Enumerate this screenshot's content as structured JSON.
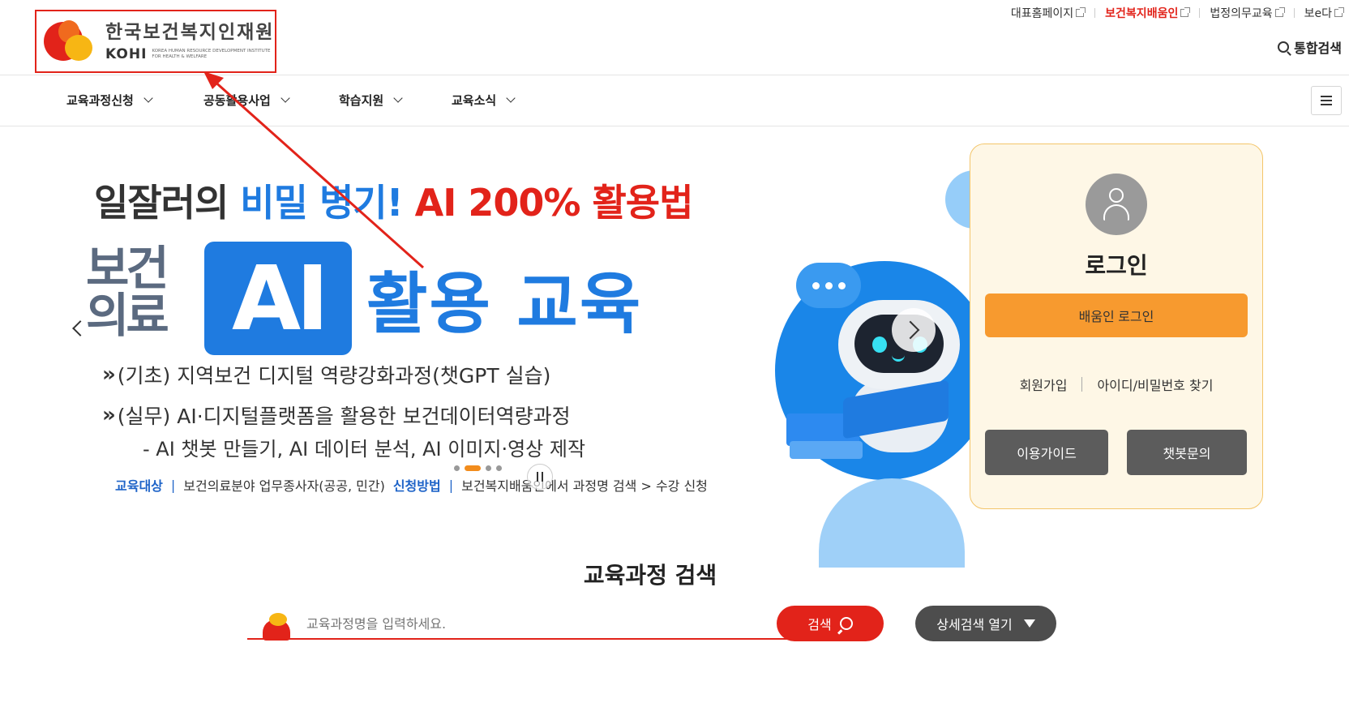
{
  "logo": {
    "name_kr": "한국보건복지인재원",
    "name_en": "KOHI",
    "full_name": "KOREA HUMAN RESOURCE DEVELOPMENT INSTITUTE FOR HEALTH & WELFARE"
  },
  "util_links": [
    {
      "label": "대표홈페이지"
    },
    {
      "label": "보건복지배움인"
    },
    {
      "label": "법정의무교육"
    },
    {
      "label": "보e다"
    }
  ],
  "total_search": "통합검색",
  "gnb": [
    {
      "label": "교육과정신청"
    },
    {
      "label": "공동활용사업"
    },
    {
      "label": "학습지원"
    },
    {
      "label": "교육소식"
    }
  ],
  "banner": {
    "headline_1": "일잘러의",
    "headline_2": "비밀 병기!",
    "headline_3": "AI 200% 활용법",
    "stack_line1": "보건",
    "stack_line2": "의료",
    "ai_box": "AI",
    "title": "활용 교육",
    "bullet_1": "(기초) 지역보건 디지털 역량강화과정(챗GPT 실습)",
    "bullet_2": "(실무) AI·디지털플랫폼을 활용한 보건데이터역량과정",
    "sub": "- AI 챗봇 만들기, AI 데이터 분석, AI 이미지·영상 제작",
    "target_label": "교육대상",
    "target_sep": "|",
    "target_text": "보건의료분야 업무종사자(공공, 민간)",
    "apply_label": "신청방법",
    "apply_sep": "|",
    "apply_text": "보건복지배움인에서 과정명 검색 > 수강 신청"
  },
  "login": {
    "title": "로그인",
    "login_button": "배움인 로그인",
    "join": "회원가입",
    "find": "아이디/비밀번호 찾기",
    "guide": "이용가이드",
    "chatbot": "챗봇문의"
  },
  "course_search": {
    "title": "교육과정 검색",
    "placeholder": "교육과정명을 입력하세요.",
    "search_button": "검색",
    "advanced_button": "상세검색 열기"
  },
  "colors": {
    "brand_red": "#e2231a",
    "brand_orange": "#f79a2f",
    "brand_blue": "#1f7be0"
  }
}
